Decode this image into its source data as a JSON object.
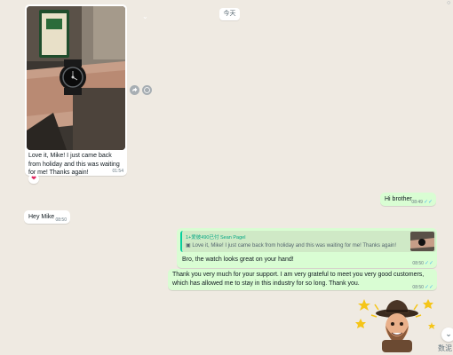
{
  "chat": {
    "date_chip": "今天",
    "corner_mark": "○"
  },
  "messages": {
    "image": {
      "caption": "Love it, Mike!  I just came back from holiday and this was waiting for me! Thanks again!",
      "time": "01:54",
      "reaction": "❤"
    },
    "hi_brother": {
      "text": "Hi brother",
      "time": "08:49"
    },
    "hey_mike": {
      "text": "Hey Mike",
      "time": "08:50"
    },
    "reply": {
      "quoted_sender": "1+爱彼490已付 Sean Pagel",
      "quoted_text": "Love it, Mike!  I just came back from holiday and this was waiting for me!  Thanks again!",
      "text": "Bro, the watch looks great on your hand!",
      "time": "08:50"
    },
    "thanks": {
      "text": "Thank you very much for your support. I am very grateful to meet you very good customers, which has allowed me to stay in this industry for so long. Thank you.",
      "time": "08:50"
    }
  },
  "controls": {
    "scroll_icon": "⌄",
    "watermark": "数泥"
  },
  "colors": {
    "outgoing_bubble": "#d9fdd3",
    "incoming_bubble": "#ffffff",
    "background": "#efeae2",
    "read_ticks": "#53bdeb"
  }
}
